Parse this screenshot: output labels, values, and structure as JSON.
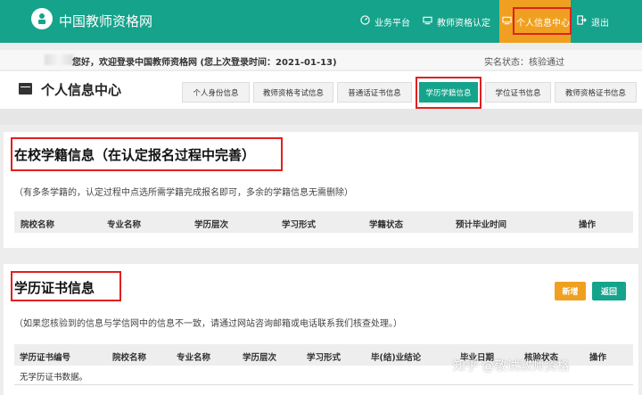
{
  "header": {
    "site_title": "中国教师资格网",
    "nav": [
      {
        "label": "业务平台",
        "icon": "dashboard-icon"
      },
      {
        "label": "教师资格认定",
        "icon": "monitor-icon"
      },
      {
        "label": "个人信息中心",
        "icon": "monitor-icon"
      },
      {
        "label": "退出",
        "icon": "logout-icon"
      }
    ],
    "colors": {
      "primary": "#15a38b",
      "accent": "#f0a020",
      "highlight": "#e02020"
    }
  },
  "welcome": {
    "text": "您好，欢迎登录中国教师资格网 (您上次登录时间：2021-01-13)",
    "status": "实名状态：核验通过"
  },
  "page": {
    "title": "个人信息中心",
    "tabs": [
      "个人身份信息",
      "教师资格考试信息",
      "普通话证书信息",
      "学历学籍信息",
      "学位证书信息",
      "教师资格证书信息"
    ],
    "active_tab": "学历学籍信息"
  },
  "section1": {
    "title": "在校学籍信息（在认定报名过程中完善）",
    "note": "（有多条学籍的，认定过程中点选所需学籍完成报名即可，多余的学籍信息无需删除）",
    "columns": [
      "院校名称",
      "专业名称",
      "学历层次",
      "学习形式",
      "学籍状态",
      "预计毕业时间",
      "操作"
    ]
  },
  "section2": {
    "title": "学历证书信息",
    "buttons": {
      "new": "新增",
      "back": "返回"
    },
    "note": "（如果您核验到的信息与学信网中的信息不一致，请通过网站咨询邮箱或电话联系我们核查处理。）",
    "columns": [
      "学历证书编号",
      "院校名称",
      "专业名称",
      "学历层次",
      "学习形式",
      "毕(结)业结论",
      "毕业日期",
      "核验状态",
      "操作"
    ],
    "empty_text": "无学历证书数据。"
  },
  "watermark": "知乎 @敬试教师资格"
}
